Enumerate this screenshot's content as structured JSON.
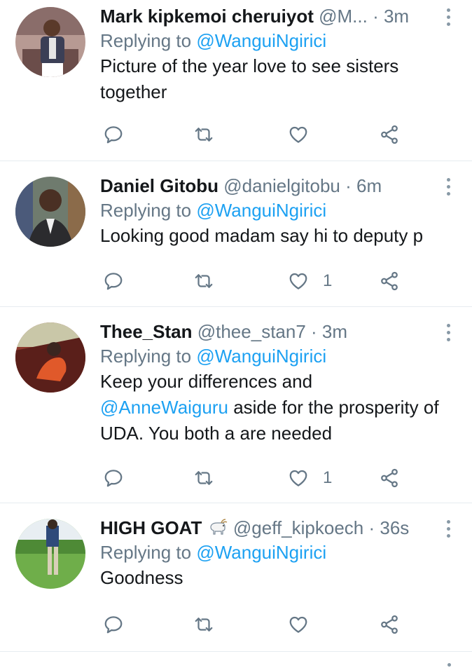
{
  "tweets": [
    {
      "name": "Mark kipkemoi cheruiyot",
      "handle": "@M...",
      "time": "· 3m",
      "replying_label": "Replying to",
      "replying_to": "@WanguiNgirici",
      "text": "Picture of the year love to see sisters together",
      "reply_count": "",
      "retweet_count": "",
      "like_count": ""
    },
    {
      "name": "Daniel Gitobu",
      "handle": "@danielgitobu",
      "time": "· 6m",
      "replying_label": "Replying to",
      "replying_to": "@WanguiNgirici",
      "text": "Looking good madam say hi to deputy p",
      "reply_count": "",
      "retweet_count": "",
      "like_count": "1"
    },
    {
      "name": "Thee_Stan",
      "handle": "@thee_stan7",
      "time": "· 3m",
      "replying_label": "Replying to",
      "replying_to": "@WanguiNgirici",
      "text_prefix": "Keep your differences and",
      "text_mention": "@AnneWaiguru",
      "text_suffix": " aside for the prosperity of UDA. You both a are needed",
      "reply_count": "",
      "retweet_count": "",
      "like_count": "1"
    },
    {
      "name": "HIGH GOAT",
      "name_emoji": "goat-emoji",
      "handle": "@geff_kipkoech",
      "time": "· 36s",
      "replying_label": "Replying to",
      "replying_to": "@WanguiNgirici",
      "text": "Goodness",
      "reply_count": "",
      "retweet_count": "",
      "like_count": ""
    }
  ],
  "icons": {
    "reply": "reply-icon",
    "retweet": "retweet-icon",
    "like": "heart-icon",
    "share": "share-icon",
    "more": "more-vertical-icon"
  },
  "colors": {
    "link": "#1da1f2",
    "secondary_text": "#657786",
    "icon": "#657786",
    "divider": "#e6ecf0"
  }
}
